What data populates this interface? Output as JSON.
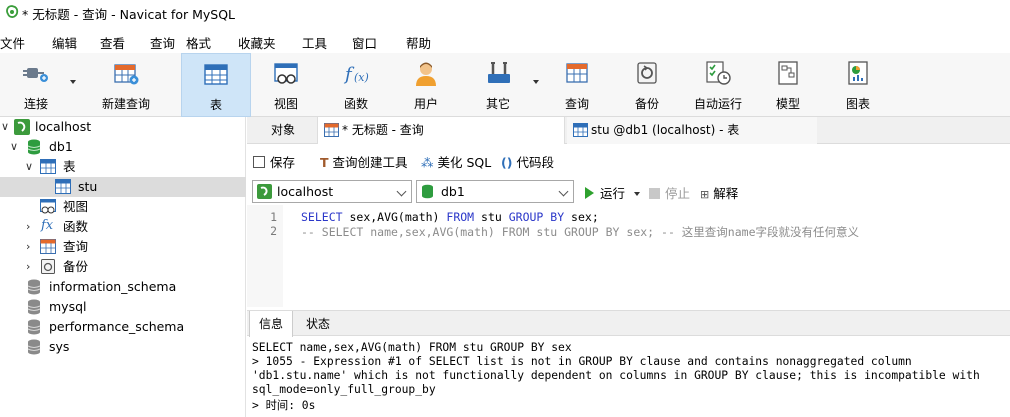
{
  "window": {
    "title": "* 无标题 - 查询 - Navicat for MySQL"
  },
  "menu": [
    "文件",
    "编辑",
    "查看",
    "查询",
    "格式",
    "收藏夹",
    "工具",
    "窗口",
    "帮助"
  ],
  "toolbar": {
    "connect": "连接",
    "new_query": "新建查询",
    "table": "表",
    "view": "视图",
    "function": "函数",
    "user": "用户",
    "other": "其它",
    "query": "查询",
    "backup": "备份",
    "automation": "自动运行",
    "model": "模型",
    "chart": "图表"
  },
  "tree": {
    "connection": "localhost",
    "db": "db1",
    "tables_label": "表",
    "table_stu": "stu",
    "views": "视图",
    "functions": "函数",
    "queries": "查询",
    "backups": "备份",
    "other_dbs": [
      "information_schema",
      "mysql",
      "performance_schema",
      "sys"
    ]
  },
  "tabs": {
    "objects": "对象",
    "query_tab": "* 无标题 - 查询",
    "table_tab": "stu @db1 (localhost) - 表"
  },
  "query_toolbar": {
    "save": "保存",
    "builder": "查询创建工具",
    "beautify": "美化 SQL",
    "snippet": "代码段"
  },
  "selectors": {
    "connection": "localhost",
    "database": "db1",
    "run": "运行",
    "stop": "停止",
    "explain": "解释"
  },
  "editor": {
    "line_numbers": [
      "1",
      "2"
    ],
    "line1": {
      "kw1": "SELECT",
      "a": " sex,AVG(math) ",
      "kw2": "FROM",
      "b": " stu ",
      "kw3": "GROUP BY",
      "c": " sex;"
    },
    "line2": "-- SELECT name,sex,AVG(math) FROM stu GROUP BY sex; -- 这里查询name字段就没有任何意义"
  },
  "result_tabs": {
    "info": "信息",
    "status": "状态"
  },
  "messages": [
    "SELECT name,sex,AVG(math) FROM stu GROUP BY sex",
    "> 1055 - Expression #1 of SELECT list is not in GROUP BY clause and contains nonaggregated column",
    "'db1.stu.name' which is not functionally dependent on columns in GROUP BY clause; this is incompatible with",
    "sql_mode=only_full_group_by",
    "> 时间: 0s"
  ],
  "colors": {
    "accent": "#cfe5f8",
    "keyword": "#2b37c9",
    "comment": "#8c8c8c",
    "run_green": "#2ea12e",
    "db_green": "#2e9c3f"
  }
}
